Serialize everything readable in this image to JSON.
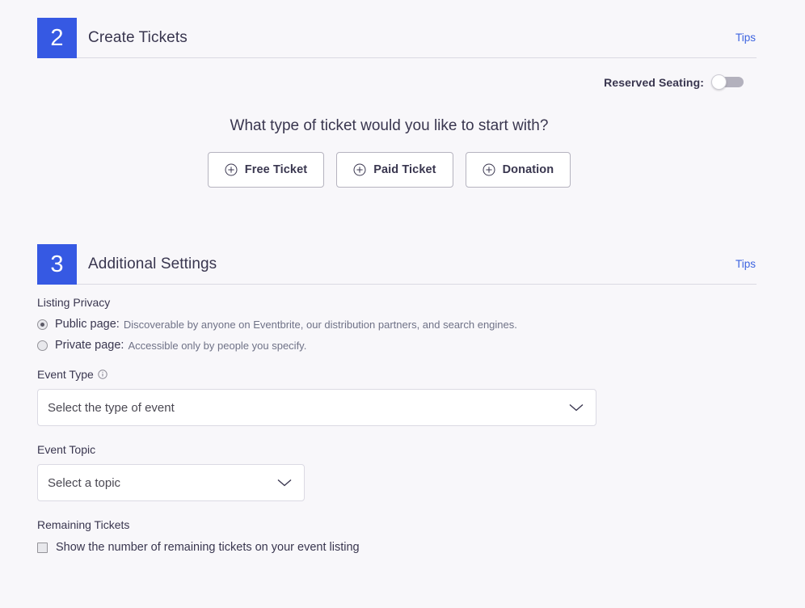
{
  "sections": [
    {
      "step": "2",
      "title": "Create Tickets",
      "tips_label": "Tips"
    },
    {
      "step": "3",
      "title": "Additional Settings",
      "tips_label": "Tips"
    }
  ],
  "create_tickets": {
    "reserved_seating": {
      "label": "Reserved Seating:",
      "state": "off"
    },
    "prompt": "What type of ticket would you like to start with?",
    "buttons": [
      {
        "label": "Free Ticket",
        "icon": "plus-circle-icon"
      },
      {
        "label": "Paid Ticket",
        "icon": "plus-circle-icon"
      },
      {
        "label": "Donation",
        "icon": "plus-circle-icon"
      }
    ]
  },
  "additional_settings": {
    "listing_privacy": {
      "label": "Listing Privacy",
      "options": [
        {
          "name": "Public page:",
          "description": "Discoverable by anyone on Eventbrite, our distribution partners, and search engines.",
          "selected": true
        },
        {
          "name": "Private page:",
          "description": "Accessible only by people you specify.",
          "selected": false
        }
      ]
    },
    "event_type": {
      "label": "Event Type",
      "info_icon": "info-circle-icon",
      "value": "Select the type of event",
      "chevron": "chevron-down-icon"
    },
    "event_topic": {
      "label": "Event Topic",
      "value": "Select a topic",
      "chevron": "chevron-down-icon"
    },
    "remaining_tickets": {
      "label": "Remaining Tickets",
      "checkbox_label": "Show the number of remaining tickets on your event listing",
      "checked": false
    }
  },
  "colors": {
    "brand_blue": "#3659e3",
    "link_blue": "#3d64e0",
    "text": "#39364f",
    "muted_text": "#6f7287",
    "background": "#f8f7fa",
    "border": "#dbdae3"
  }
}
